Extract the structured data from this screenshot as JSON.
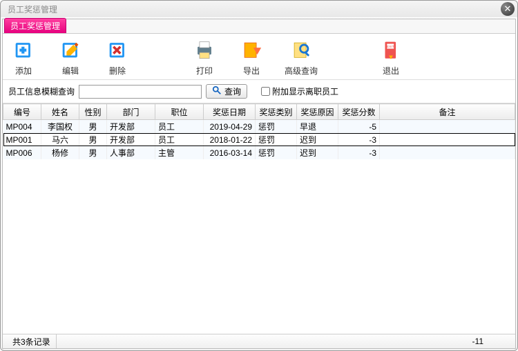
{
  "window": {
    "title": "员工奖惩管理"
  },
  "tab": {
    "label": "员工奖惩管理"
  },
  "toolbar": {
    "add": "添加",
    "edit": "编辑",
    "delete": "删除",
    "print": "打印",
    "export": "导出",
    "advsearch": "高级查询",
    "exit": "退出"
  },
  "search": {
    "label": "员工信息模糊查询",
    "value": "",
    "button": "查询",
    "checkbox_label": "附加显示离职员工",
    "checked": false
  },
  "columns": [
    "编号",
    "姓名",
    "性别",
    "部门",
    "职位",
    "奖惩日期",
    "奖惩类别",
    "奖惩原因",
    "奖惩分数",
    "备注"
  ],
  "rows": [
    {
      "id": "MP004",
      "name": "李国权",
      "sex": "男",
      "dept": "开发部",
      "pos": "员工",
      "date": "2019-04-29",
      "type": "惩罚",
      "reason": "早退",
      "score": "-5",
      "note": ""
    },
    {
      "id": "MP001",
      "name": "马六",
      "sex": "男",
      "dept": "开发部",
      "pos": "员工",
      "date": "2018-01-22",
      "type": "惩罚",
      "reason": "迟到",
      "score": "-3",
      "note": ""
    },
    {
      "id": "MP006",
      "name": "杨修",
      "sex": "男",
      "dept": "人事部",
      "pos": "主管",
      "date": "2016-03-14",
      "type": "惩罚",
      "reason": "迟到",
      "score": "-3",
      "note": ""
    }
  ],
  "selected_index": 1,
  "status": {
    "count_text": "共3条记录",
    "total": "-11"
  }
}
